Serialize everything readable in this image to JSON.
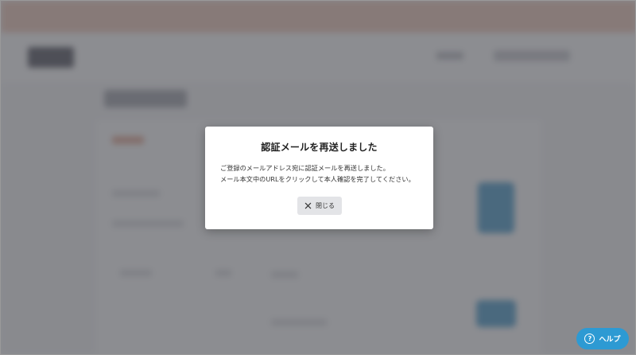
{
  "dialog": {
    "title": "認証メールを再送しました",
    "message_line1": "ご登録のメールアドレス宛に認証メールを再送しました。",
    "message_line2": "メール本文中のURLをクリックして本人確認を完了してください。",
    "close_label": "閉じる",
    "close_icon": "close-icon"
  },
  "help": {
    "label": "ヘルプ",
    "icon": "question-circle-icon",
    "icon_glyph": "?"
  },
  "colors": {
    "overlay": "#505258",
    "help_button": "#2d9ad3",
    "close_button": "#e3e4e7"
  }
}
